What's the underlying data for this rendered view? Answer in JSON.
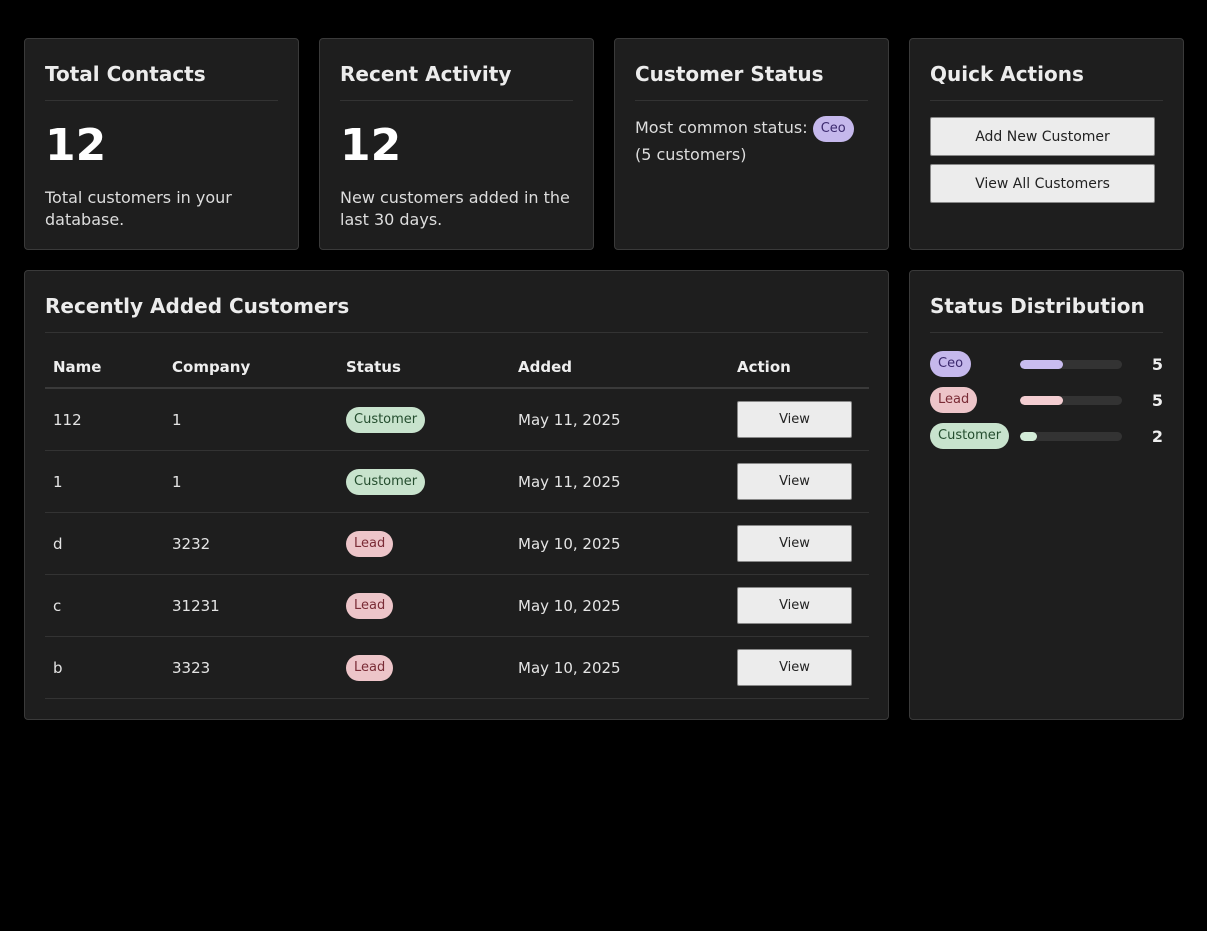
{
  "cards": {
    "total_contacts": {
      "title": "Total Contacts",
      "value": "12",
      "description": "Total customers in your database."
    },
    "recent_activity": {
      "title": "Recent Activity",
      "value": "12",
      "description": "New customers added in the last 30 days."
    },
    "customer_status": {
      "title": "Customer Status",
      "prefix": "Most common status:",
      "badge": "Ceo",
      "suffix": "(5 customers)"
    },
    "quick_actions": {
      "title": "Quick Actions",
      "add_label": "Add New Customer",
      "view_all_label": "View All Customers"
    }
  },
  "recent_customers": {
    "title": "Recently Added Customers",
    "columns": [
      "Name",
      "Company",
      "Status",
      "Added",
      "Action"
    ],
    "rows": [
      {
        "name": "112",
        "company": "1",
        "status": "Customer",
        "status_class": "customer",
        "added": "May 11, 2025",
        "action": "View"
      },
      {
        "name": "1",
        "company": "1",
        "status": "Customer",
        "status_class": "customer",
        "added": "May 11, 2025",
        "action": "View"
      },
      {
        "name": "d",
        "company": "3232",
        "status": "Lead",
        "status_class": "lead",
        "added": "May 10, 2025",
        "action": "View"
      },
      {
        "name": "c",
        "company": "31231",
        "status": "Lead",
        "status_class": "lead",
        "added": "May 10, 2025",
        "action": "View"
      },
      {
        "name": "b",
        "company": "3323",
        "status": "Lead",
        "status_class": "lead",
        "added": "May 10, 2025",
        "action": "View"
      }
    ]
  },
  "status_distribution": {
    "title": "Status Distribution",
    "items": [
      {
        "label": "Ceo",
        "status_class": "ceo",
        "count": "5",
        "fraction": 0.42,
        "color": "#c9bcef"
      },
      {
        "label": "Lead",
        "status_class": "lead",
        "count": "5",
        "fraction": 0.42,
        "color": "#f3cdd1"
      },
      {
        "label": "Customer",
        "status_class": "customer",
        "count": "2",
        "fraction": 0.17,
        "color": "#d3ecd8"
      }
    ]
  }
}
